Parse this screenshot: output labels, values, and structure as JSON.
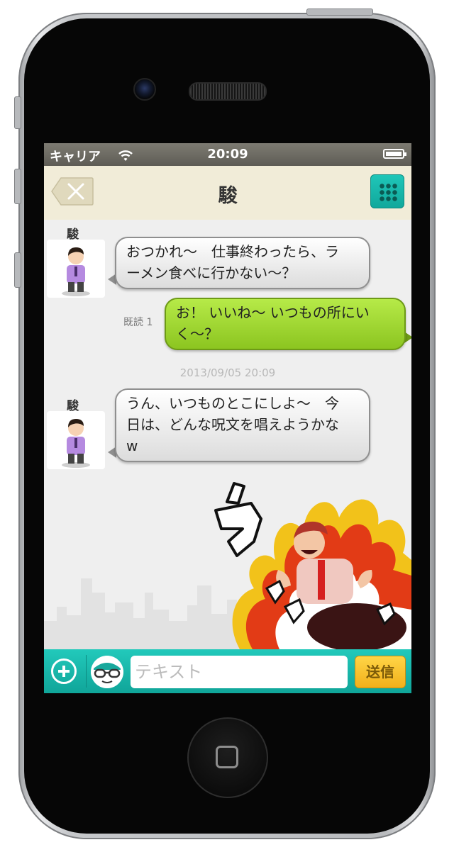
{
  "status_bar": {
    "carrier": "キャリア",
    "time": "20:09"
  },
  "nav": {
    "title": "駿"
  },
  "messages": [
    {
      "sender": "駿",
      "direction": "incoming",
      "lines": [
        "おつかれ〜　仕事終わったら、ラ",
        "ーメン食べに行かない〜？"
      ]
    },
    {
      "direction": "outgoing",
      "read_receipt": "既読 1",
      "lines": [
        "お！ いいね〜 いつもの所にい",
        "く〜？"
      ]
    },
    {
      "separator": "2013/09/05 20:09"
    },
    {
      "sender": "駿",
      "direction": "incoming",
      "lines": [
        "うん、いつものとこにしよ〜　今",
        "日は、どんな呪文を唱えようかな",
        "w"
      ]
    },
    {
      "sticker_text": "うォォォ"
    }
  ],
  "input_bar": {
    "placeholder": "テキスト",
    "send_label": "送信"
  },
  "colors": {
    "accent": "#1bbcae",
    "outgoing_bubble": "#a7dc3a",
    "send_button": "#f5c02a",
    "navbar": "#f1ecd8"
  }
}
